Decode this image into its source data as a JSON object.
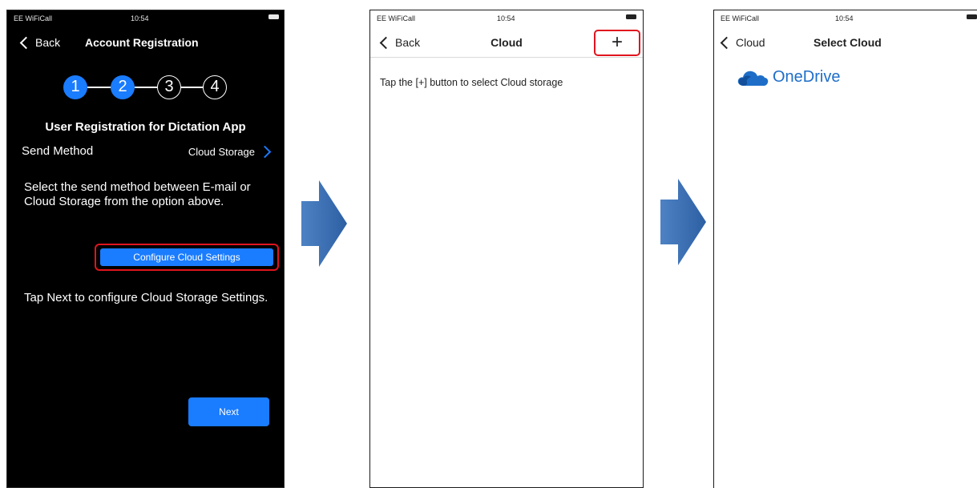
{
  "panel1": {
    "status": {
      "carrier": "EE WiFiCall",
      "time": "10:54"
    },
    "nav": {
      "back_label": "Back",
      "title": "Account Registration"
    },
    "steps": [
      "1",
      "2",
      "3",
      "4"
    ],
    "heading": "User Registration for Dictation App",
    "send_method": {
      "label": "Send Method",
      "value": "Cloud Storage"
    },
    "instructions": "Select the send method between E-mail or Cloud Storage from the option above.",
    "configure_button": "Configure Cloud Settings",
    "next_hint": "Tap Next to configure Cloud Storage Settings.",
    "next_button": "Next"
  },
  "panel2": {
    "status": {
      "carrier": "EE WiFiCall",
      "time": "10:54"
    },
    "nav": {
      "back_label": "Back",
      "title": "Cloud",
      "add_label": "+"
    },
    "hint": "Tap the [+] button to select Cloud storage"
  },
  "panel3": {
    "status": {
      "carrier": "EE WiFiCall",
      "time": "10:54"
    },
    "nav": {
      "back_label": "Cloud",
      "title": "Select Cloud"
    },
    "providers": [
      "OneDrive"
    ]
  },
  "colors": {
    "accent": "#1a7cff",
    "highlight": "#e0141e",
    "arrow": "#3a6fb0",
    "onedrive": "#1e6ec8"
  }
}
